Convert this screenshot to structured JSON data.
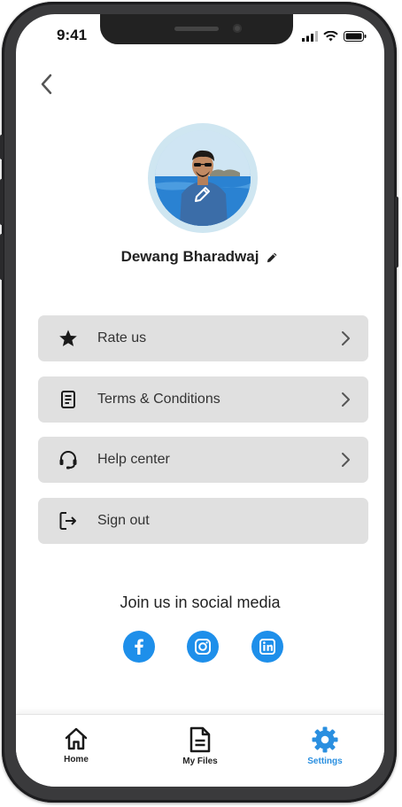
{
  "status_bar": {
    "time": "9:41"
  },
  "profile": {
    "name": "Dewang Bharadwaj"
  },
  "menu": [
    {
      "label": "Rate us",
      "icon": "star-icon"
    },
    {
      "label": "Terms & Conditions",
      "icon": "document-icon"
    },
    {
      "label": "Help center",
      "icon": "headset-icon"
    },
    {
      "label": "Sign out",
      "icon": "sign-out-icon"
    }
  ],
  "social": {
    "title": "Join us in social media",
    "links": [
      "facebook-icon",
      "instagram-icon",
      "linkedin-icon"
    ]
  },
  "tabs": [
    {
      "label": "Home",
      "icon": "home-icon",
      "active": false
    },
    {
      "label": "My Files",
      "icon": "file-icon",
      "active": false
    },
    {
      "label": "Settings",
      "icon": "gear-icon",
      "active": true
    }
  ],
  "colors": {
    "accent": "#1e8fea",
    "menu_bg": "#e0e0e0",
    "active_tab": "#2a8fe0"
  }
}
